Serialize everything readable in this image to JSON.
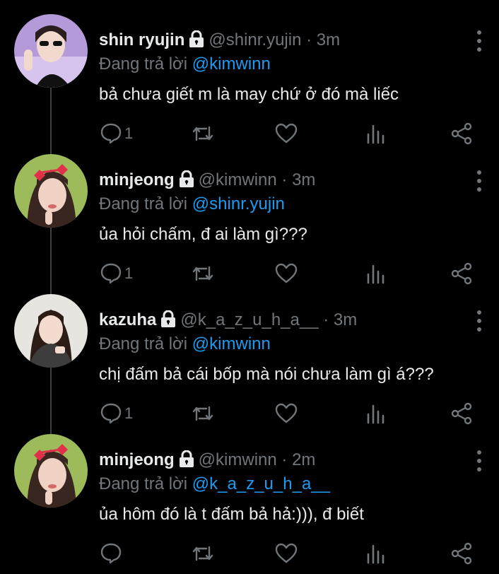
{
  "reply_prefix": "Đang trả lời",
  "tweets": [
    {
      "name": "shin ryujin",
      "handle": "@shinr.yujin",
      "separator": "·",
      "time": "3m",
      "reply_to": "@kimwinn",
      "text": "bả chưa giết m là may chứ ở đó mà liếc",
      "reply_count": "1",
      "avatar_bg": "#b49ad8"
    },
    {
      "name": "minjeong",
      "handle": "@kimwinn",
      "separator": "·",
      "time": "3m",
      "reply_to": "@shinr.yujin",
      "text": "ủa hỏi chấm, đ ai làm gì???",
      "reply_count": "1",
      "avatar_bg": "#9dbb5a"
    },
    {
      "name": "kazuha",
      "handle": "@k_a_z_u_h_a__",
      "separator": "·",
      "time": "3m",
      "reply_to": "@kimwinn",
      "text": "chị đấm bả cái bốp mà nói chưa làm gì á???",
      "reply_count": "1",
      "avatar_bg": "#e7e5e0"
    },
    {
      "name": "minjeong",
      "handle": "@kimwinn",
      "separator": "·",
      "time": "2m",
      "reply_to": "@k_a_z_u_h_a__",
      "text": "ủa hôm đó là t đấm bả hả:))), đ biết",
      "reply_count": "",
      "avatar_bg": "#9dbb5a"
    }
  ],
  "icons": {
    "reply": "reply-icon",
    "retweet": "retweet-icon",
    "like": "heart-icon",
    "views": "views-icon",
    "share": "share-icon",
    "lock": "lock-icon",
    "menu": "more-vertical-icon"
  },
  "colors": {
    "background": "#000000",
    "text": "#e7e9ea",
    "muted": "#71767b",
    "mention": "#1d9bf0",
    "thread_line": "#3a3f44"
  }
}
